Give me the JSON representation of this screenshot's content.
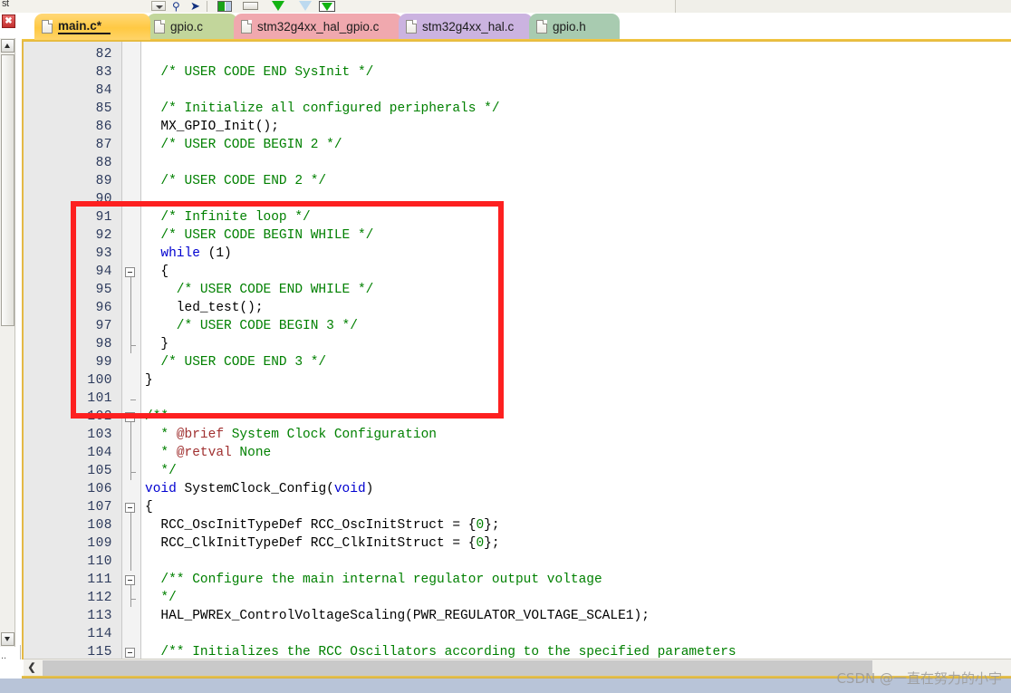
{
  "toolbar": {
    "label_fragment": "st",
    "icons": [
      {
        "name": "combo-dropdown-icon"
      },
      {
        "name": "binoculars-find-icon"
      },
      {
        "name": "find-next-arrow-icon"
      },
      {
        "name": "bookmark-toggle-icon"
      },
      {
        "name": "insert-block-icon"
      },
      {
        "name": "next-bookmark-icon"
      },
      {
        "name": "previous-bookmark-icon"
      },
      {
        "name": "clear-bookmarks-icon"
      }
    ]
  },
  "window_chrome": {
    "close_glyph": "✖",
    "ellipsis": "..",
    "scroll_up_glyph": "▲",
    "scroll_down_glyph": "▼",
    "hscroll_left_glyph": "❮"
  },
  "tabs": [
    {
      "label": "main.c*",
      "color": "#ffc943",
      "active": true,
      "modified": true
    },
    {
      "label": "gpio.c",
      "color": "#c2d69b",
      "active": false,
      "modified": false
    },
    {
      "label": "stm32g4xx_hal_gpio.c",
      "color": "#f0a8ae",
      "active": false,
      "modified": false
    },
    {
      "label": "stm32g4xx_hal.c",
      "color": "#cbb3e0",
      "active": false,
      "modified": false
    },
    {
      "label": "gpio.h",
      "color": "#a8cbb0",
      "active": false,
      "modified": false
    }
  ],
  "annotation": {
    "type": "red-rectangle-highlight",
    "color": "#fd2020",
    "covers_lines": "91-102"
  },
  "watermark": "CSDN @一直在努力的小宇",
  "editor": {
    "first_line": 82,
    "last_line": 115,
    "lines": [
      {
        "n": 82,
        "tokens": [],
        "fold": null
      },
      {
        "n": 83,
        "tokens": [
          {
            "t": "  /* USER CODE END SysInit */",
            "c": "cmt"
          }
        ],
        "fold": null
      },
      {
        "n": 84,
        "tokens": [],
        "fold": null
      },
      {
        "n": 85,
        "tokens": [
          {
            "t": "  /* Initialize all configured peripherals */",
            "c": "cmt"
          }
        ],
        "fold": null
      },
      {
        "n": 86,
        "tokens": [
          {
            "t": "  MX_GPIO_Init();",
            "c": "plain"
          }
        ],
        "fold": null
      },
      {
        "n": 87,
        "tokens": [
          {
            "t": "  /* USER CODE BEGIN 2 */",
            "c": "cmt"
          }
        ],
        "fold": null
      },
      {
        "n": 88,
        "tokens": [],
        "fold": null
      },
      {
        "n": 89,
        "tokens": [
          {
            "t": "  /* USER CODE END 2 */",
            "c": "cmt"
          }
        ],
        "fold": null
      },
      {
        "n": 90,
        "tokens": [],
        "fold": null
      },
      {
        "n": 91,
        "tokens": [
          {
            "t": "  /* Infinite loop */",
            "c": "cmt"
          }
        ],
        "fold": null
      },
      {
        "n": 92,
        "tokens": [
          {
            "t": "  /* USER CODE BEGIN WHILE */",
            "c": "cmt"
          }
        ],
        "fold": null
      },
      {
        "n": 93,
        "tokens": [
          {
            "t": "  ",
            "c": "plain"
          },
          {
            "t": "while",
            "c": "kw"
          },
          {
            "t": " (1)",
            "c": "plain"
          }
        ],
        "fold": null
      },
      {
        "n": 94,
        "tokens": [
          {
            "t": "  {",
            "c": "plain"
          }
        ],
        "fold": "start"
      },
      {
        "n": 95,
        "tokens": [
          {
            "t": "    /* USER CODE END WHILE */",
            "c": "cmt"
          }
        ],
        "fold": "mid"
      },
      {
        "n": 96,
        "tokens": [
          {
            "t": "    led_test();",
            "c": "plain"
          }
        ],
        "fold": "mid"
      },
      {
        "n": 97,
        "tokens": [
          {
            "t": "    /* USER CODE BEGIN 3 */",
            "c": "cmt"
          }
        ],
        "fold": "mid"
      },
      {
        "n": 98,
        "tokens": [
          {
            "t": "  }",
            "c": "plain"
          }
        ],
        "fold": "end"
      },
      {
        "n": 99,
        "tokens": [
          {
            "t": "  /* USER CODE END 3 */",
            "c": "cmt"
          }
        ],
        "fold": "mid2"
      },
      {
        "n": 100,
        "tokens": [
          {
            "t": "}",
            "c": "plain"
          }
        ],
        "fold": "mid2"
      },
      {
        "n": 101,
        "tokens": [],
        "fold": "end2"
      },
      {
        "n": 102,
        "tokens": [
          {
            "t": "/**",
            "c": "cmt"
          }
        ],
        "fold": "start"
      },
      {
        "n": 103,
        "tokens": [
          {
            "t": "  * ",
            "c": "cmt"
          },
          {
            "t": "@brief",
            "c": "doc"
          },
          {
            "t": " System Clock Configuration",
            "c": "cmt"
          }
        ],
        "fold": "mid"
      },
      {
        "n": 104,
        "tokens": [
          {
            "t": "  * ",
            "c": "cmt"
          },
          {
            "t": "@retval",
            "c": "doc"
          },
          {
            "t": " None",
            "c": "cmt"
          }
        ],
        "fold": "mid"
      },
      {
        "n": 105,
        "tokens": [
          {
            "t": "  */",
            "c": "cmt"
          }
        ],
        "fold": "end"
      },
      {
        "n": 106,
        "tokens": [
          {
            "t": "",
            "c": "plain"
          },
          {
            "t": "void",
            "c": "kw"
          },
          {
            "t": " SystemClock_Config(",
            "c": "plain"
          },
          {
            "t": "void",
            "c": "kw"
          },
          {
            "t": ")",
            "c": "plain"
          }
        ],
        "fold": null
      },
      {
        "n": 107,
        "tokens": [
          {
            "t": "{",
            "c": "plain"
          }
        ],
        "fold": "start"
      },
      {
        "n": 108,
        "tokens": [
          {
            "t": "  RCC_OscInitTypeDef RCC_OscInitStruct = {",
            "c": "plain"
          },
          {
            "t": "0",
            "c": "num"
          },
          {
            "t": "};",
            "c": "plain"
          }
        ],
        "fold": "mid"
      },
      {
        "n": 109,
        "tokens": [
          {
            "t": "  RCC_ClkInitTypeDef RCC_ClkInitStruct = {",
            "c": "plain"
          },
          {
            "t": "0",
            "c": "num"
          },
          {
            "t": "};",
            "c": "plain"
          }
        ],
        "fold": "mid"
      },
      {
        "n": 110,
        "tokens": [],
        "fold": "mid"
      },
      {
        "n": 111,
        "tokens": [
          {
            "t": "  /** Configure the main internal regulator output voltage",
            "c": "cmt"
          }
        ],
        "fold": "start"
      },
      {
        "n": 112,
        "tokens": [
          {
            "t": "  */",
            "c": "cmt"
          }
        ],
        "fold": "end"
      },
      {
        "n": 113,
        "tokens": [
          {
            "t": "  HAL_PWREx_ControlVoltageScaling(PWR_REGULATOR_VOLTAGE_SCALE1);",
            "c": "plain"
          }
        ],
        "fold": "mid"
      },
      {
        "n": 114,
        "tokens": [],
        "fold": "mid"
      },
      {
        "n": 115,
        "tokens": [
          {
            "t": "  /** Initializes the RCC Oscillators according to the specified parameters",
            "c": "cmt"
          }
        ],
        "fold": "start"
      }
    ]
  }
}
